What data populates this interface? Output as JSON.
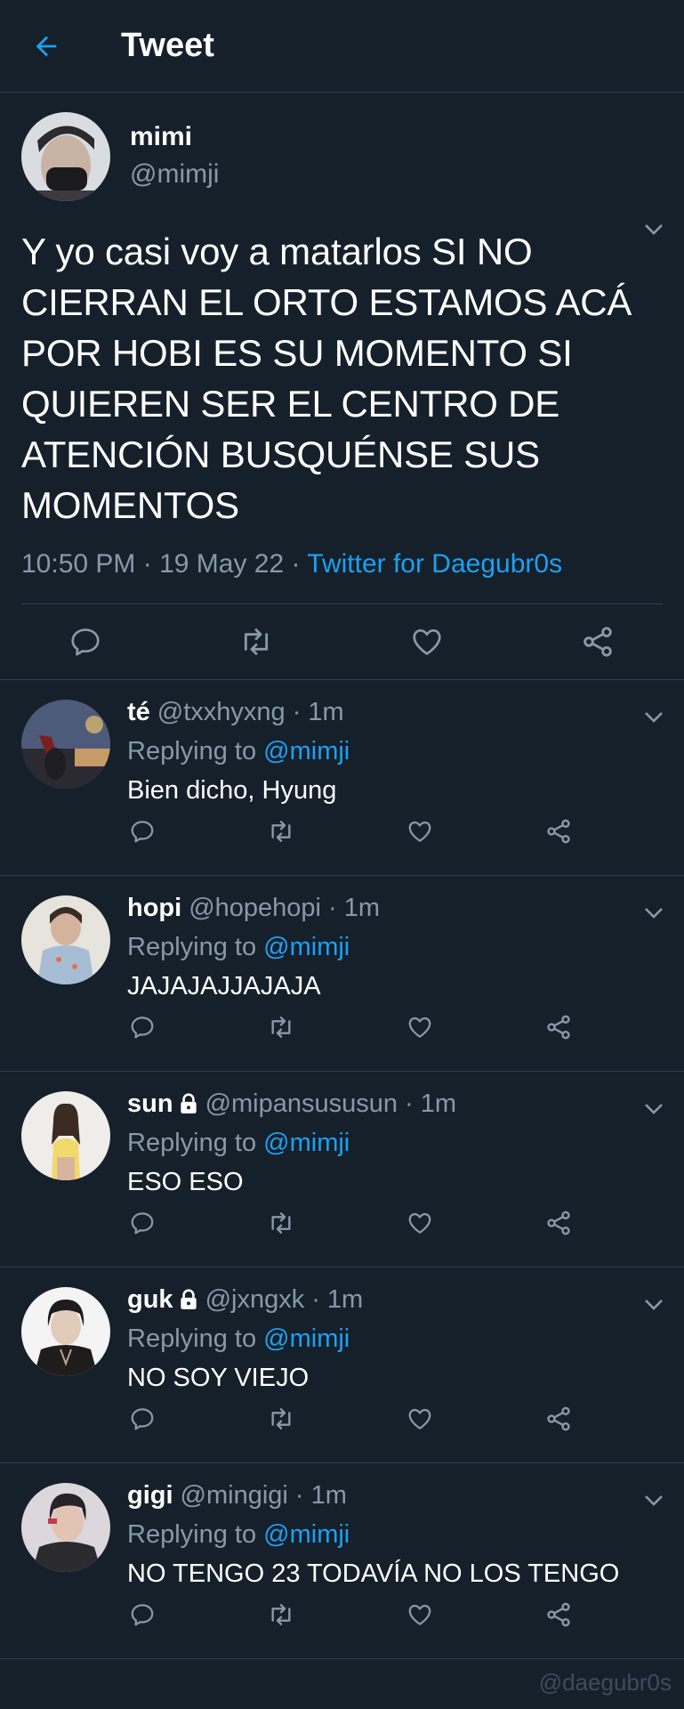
{
  "header": {
    "title": "Tweet"
  },
  "main_tweet": {
    "name": "mimi",
    "handle": "@mimji",
    "text": "Y yo casi voy a matarlos SI NO CIERRAN EL ORTO ESTAMOS ACÁ POR HOBI ES SU MOMENTO SI QUIEREN SER EL CENTRO DE ATENCIÓN BUSQUÉNSE SUS MOMENTOS",
    "time": "10:50 PM · 19 May 22 · ",
    "source": "Twitter for Daegubr0s"
  },
  "replies": [
    {
      "name": "té",
      "handle": "@txxhyxng",
      "time": "· 1m",
      "replying_label": "Replying to ",
      "mention": "@mimji",
      "text": "Bien dicho, Hyung",
      "locked": false
    },
    {
      "name": "hopi",
      "handle": "@hopehopi",
      "time": "· 1m",
      "replying_label": "Replying to ",
      "mention": "@mimji",
      "text": "JAJAJAJJAJAJA",
      "locked": false
    },
    {
      "name": "sun",
      "handle": "@mipansususun",
      "time": "· 1m",
      "replying_label": "Replying to ",
      "mention": "@mimji",
      "text": "ESO ESO",
      "locked": true
    },
    {
      "name": "guk",
      "handle": "@jxngxk",
      "time": "· 1m",
      "replying_label": "Replying to ",
      "mention": "@mimji",
      "text": "NO SOY VIEJO",
      "locked": true
    },
    {
      "name": "gigi",
      "handle": "@mingigi",
      "time": "· 1m",
      "replying_label": "Replying to ",
      "mention": "@mimji",
      "text": "NO TENGO 23 TODAVÍA NO LOS TENGO",
      "locked": false
    }
  ],
  "watermark": "@daegubr0s",
  "icons": [
    "back-arrow-icon",
    "chevron-down-icon",
    "reply-icon",
    "retweet-icon",
    "like-icon",
    "share-icon",
    "lock-icon"
  ],
  "colors": {
    "background": "#15202b",
    "accent": "#1da1f2",
    "secondary_text": "#8899a6",
    "divider": "#2f3d4c"
  }
}
